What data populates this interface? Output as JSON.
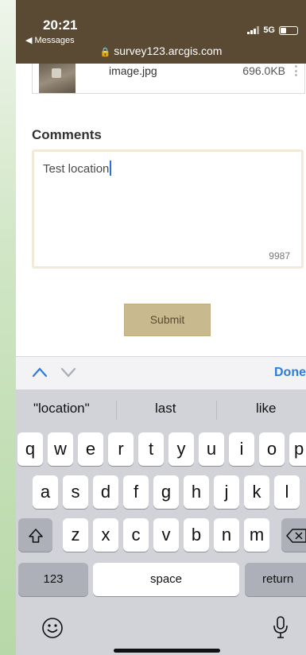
{
  "status": {
    "time": "20:21",
    "back_app": "◀ Messages",
    "network": "5G",
    "url": "survey123.arcgis.com"
  },
  "attachment": {
    "filename": "image.jpg",
    "size": "696.0KB"
  },
  "comments": {
    "label": "Comments",
    "text": "Test location",
    "remaining": "9987"
  },
  "submit_label": "Submit",
  "accessory": {
    "done_label": "Done"
  },
  "keyboard": {
    "suggestions": [
      "\"location\"",
      "last",
      "like"
    ],
    "row1": [
      "q",
      "w",
      "e",
      "r",
      "t",
      "y",
      "u",
      "i",
      "o",
      "p"
    ],
    "row2": [
      "a",
      "s",
      "d",
      "f",
      "g",
      "h",
      "j",
      "k",
      "l"
    ],
    "row3": [
      "z",
      "x",
      "c",
      "v",
      "b",
      "n",
      "m"
    ],
    "numbers_label": "123",
    "space_label": "space",
    "return_label": "return"
  },
  "colors": {
    "header": "#5b4a33",
    "accent": "#c8b98e",
    "ios_blue": "#2a7de0"
  }
}
